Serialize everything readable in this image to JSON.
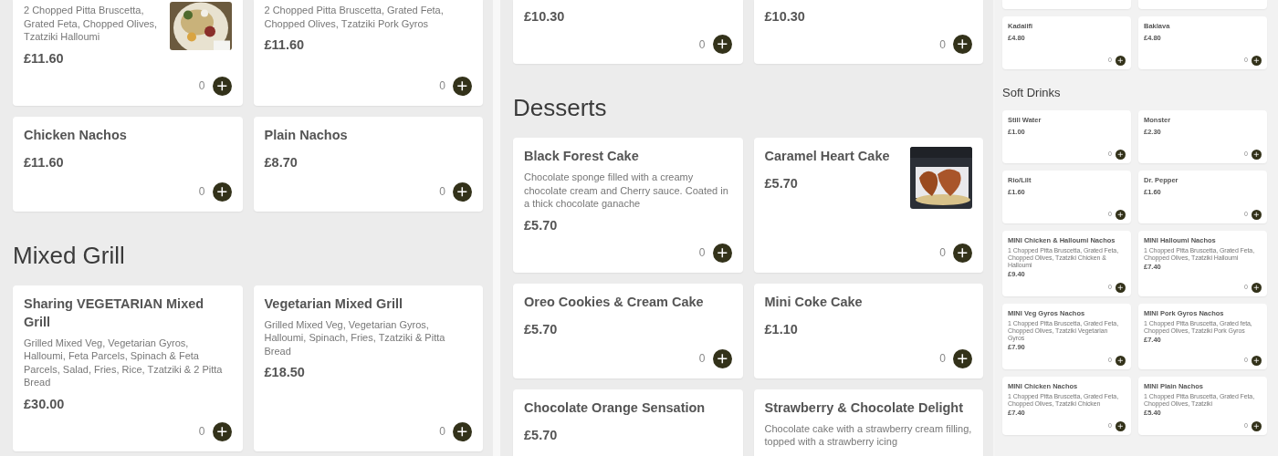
{
  "columns": [
    {
      "kind": "regular",
      "sections": [
        {
          "items": [
            {
              "kind": "cut",
              "description": "2 Chopped Pitta Bruscetta, Grated Feta, Chopped Olives, Tzatziki Halloumi",
              "price": "£11.60",
              "quantity": "0",
              "photo": true
            },
            {
              "kind": "cut",
              "description": "2 Chopped Pitta Bruscetta, Grated Feta, Chopped Olives, Tzatziki Pork Gyros",
              "price": "£11.60",
              "quantity": "0"
            },
            {
              "kind": "card",
              "title": "Chicken Nachos",
              "price": "£11.60",
              "quantity": "0"
            },
            {
              "kind": "card",
              "title": "Plain Nachos",
              "price": "£8.70",
              "quantity": "0"
            }
          ]
        },
        {
          "heading": "Mixed Grill",
          "items": [
            {
              "kind": "card",
              "title": "Sharing VEGETARIAN Mixed Grill",
              "description": "Grilled Mixed Veg, Vegetarian Gyros, Halloumi, Feta Parcels, Spinach & Feta Parcels, Salad, Fries, Rice, Tzatziki & 2 Pitta Bread",
              "price": "£30.00",
              "quantity": "0"
            },
            {
              "kind": "card",
              "title": "Vegetarian Mixed Grill",
              "description": "Grilled Mixed Veg, Vegetarian Gyros, Halloumi, Spinach, Fries, Tzatziki & Pitta Bread",
              "price": "£18.50",
              "quantity": "0"
            }
          ]
        }
      ]
    },
    {
      "kind": "regular",
      "sections": [
        {
          "items": [
            {
              "kind": "cut",
              "price": "£10.30",
              "quantity": "0"
            },
            {
              "kind": "cut",
              "price": "£10.30",
              "quantity": "0"
            }
          ]
        },
        {
          "heading": "Desserts",
          "items": [
            {
              "kind": "card",
              "title": "Black Forest Cake",
              "description": "Chocolate sponge filled with a creamy chocolate cream and  Cherry sauce. Coated in a thick chocolate ganache",
              "price": "£5.70",
              "quantity": "0"
            },
            {
              "kind": "card",
              "title": "Caramel Heart Cake",
              "price": "£5.70",
              "quantity": "0",
              "photo": true
            },
            {
              "kind": "card",
              "title": "Oreo Cookies & Cream Cake",
              "price": "£5.70",
              "quantity": "0"
            },
            {
              "kind": "card",
              "title": "Mini Coke Cake",
              "price": "£1.10",
              "quantity": "0"
            },
            {
              "kind": "card",
              "title": "Chocolate Orange Sensation",
              "price": "£5.70"
            },
            {
              "kind": "card",
              "title": "Strawberry & Chocolate Delight",
              "description": "Chocolate cake with a strawberry cream filling, topped with a strawberry icing"
            }
          ]
        }
      ]
    },
    {
      "kind": "compact",
      "sections": [
        {
          "items": [
            {
              "kind": "tail"
            },
            {
              "kind": "tail"
            },
            {
              "kind": "card",
              "title": "Kadaiifi",
              "price": "£4.80",
              "quantity": "0"
            },
            {
              "kind": "card",
              "title": "Baklava",
              "price": "£4.80",
              "quantity": "0"
            }
          ]
        },
        {
          "heading": "Soft Drinks",
          "items": [
            {
              "kind": "card",
              "title": "Still Water",
              "price": "£1.00",
              "quantity": "0"
            },
            {
              "kind": "card",
              "title": "Monster",
              "price": "£2.30",
              "quantity": "0"
            },
            {
              "kind": "card",
              "title": "Rio/Lilt",
              "price": "£1.60",
              "quantity": "0"
            },
            {
              "kind": "card",
              "title": "Dr. Pepper",
              "price": "£1.60",
              "quantity": "0"
            }
          ]
        },
        {
          "items": [
            {
              "kind": "card",
              "title": "MINI Chicken & Halloumi Nachos",
              "description": "1 Chopped Pitta Bruscetta, Grated Feta, Chopped Olives, Tzatziki Chicken & Halloumi",
              "price": "£9.40",
              "quantity": "0"
            },
            {
              "kind": "card",
              "title": "MINI Halloumi Nachos",
              "description": "1 Chopped Pitta Bruscetta, Grated Feta, Chopped Olives, Tzatziki Halloumi",
              "price": "£7.40",
              "quantity": "0"
            },
            {
              "kind": "card",
              "title": "MINI Veg Gyros Nachos",
              "description": "1 Chopped Pitta Bruscetta, Grated Feta, Chopped Olives, Tzatziki Vegetarian Gyros",
              "price": "£7.90",
              "quantity": "0"
            },
            {
              "kind": "card",
              "title": "MINI Pork Gyros Nachos",
              "description": "1 Chopped Pitta Bruscetta, Grated feta, Chopped Olives, Tzatziki Pork Gyros",
              "price": "£7.40",
              "quantity": "0"
            },
            {
              "kind": "card",
              "title": "MINI Chicken Nachos",
              "description": "1 Chopped Pitta Bruscetta, Grated Feta, Chopped Olives, Tzatziki Chicken",
              "price": "£7.40",
              "quantity": "0"
            },
            {
              "kind": "card",
              "title": "MINI Plain Nachos",
              "description": "1 Chopped Pitta Bruscetta, Grated Feta, Chopped Olives, Tzatziki",
              "price": "£5.40",
              "quantity": "0"
            }
          ]
        }
      ]
    }
  ]
}
